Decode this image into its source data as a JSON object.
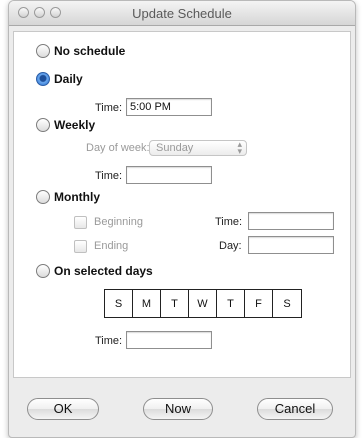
{
  "window": {
    "title": "Update Schedule"
  },
  "options": {
    "no_schedule": "No schedule",
    "daily": "Daily",
    "weekly": "Weekly",
    "monthly": "Monthly",
    "on_selected_days": "On selected days",
    "selected": "daily"
  },
  "daily": {
    "time_label": "Time:",
    "time_value": "5:00 PM"
  },
  "weekly": {
    "day_of_week_label": "Day of week:",
    "day_of_week_value": "Sunday",
    "time_label": "Time:",
    "time_value": ""
  },
  "monthly": {
    "beginning_label": "Beginning",
    "ending_label": "Ending",
    "time_label": "Time:",
    "time_value": "",
    "day_label": "Day:",
    "day_value": ""
  },
  "selected_days": {
    "days": [
      "S",
      "M",
      "T",
      "W",
      "T",
      "F",
      "S"
    ],
    "time_label": "Time:",
    "time_value": ""
  },
  "buttons": {
    "ok": "OK",
    "now": "Now",
    "cancel": "Cancel"
  }
}
